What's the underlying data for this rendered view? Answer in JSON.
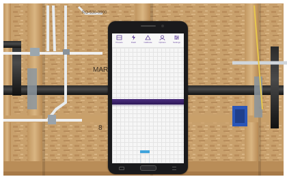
{
  "app": {
    "toolbar": [
      {
        "label": "Presets",
        "icon": "presets-icon"
      },
      {
        "label": "Flash",
        "icon": "flash-icon"
      },
      {
        "label": "Calibrate",
        "icon": "calibrate-icon"
      },
      {
        "label": "Options",
        "icon": "options-icon"
      },
      {
        "label": "Settings",
        "icon": "settings-icon"
      }
    ]
  },
  "colors": {
    "accent": "#5a3a96",
    "band": "#3b2168",
    "meter": "#3fa3dc"
  }
}
